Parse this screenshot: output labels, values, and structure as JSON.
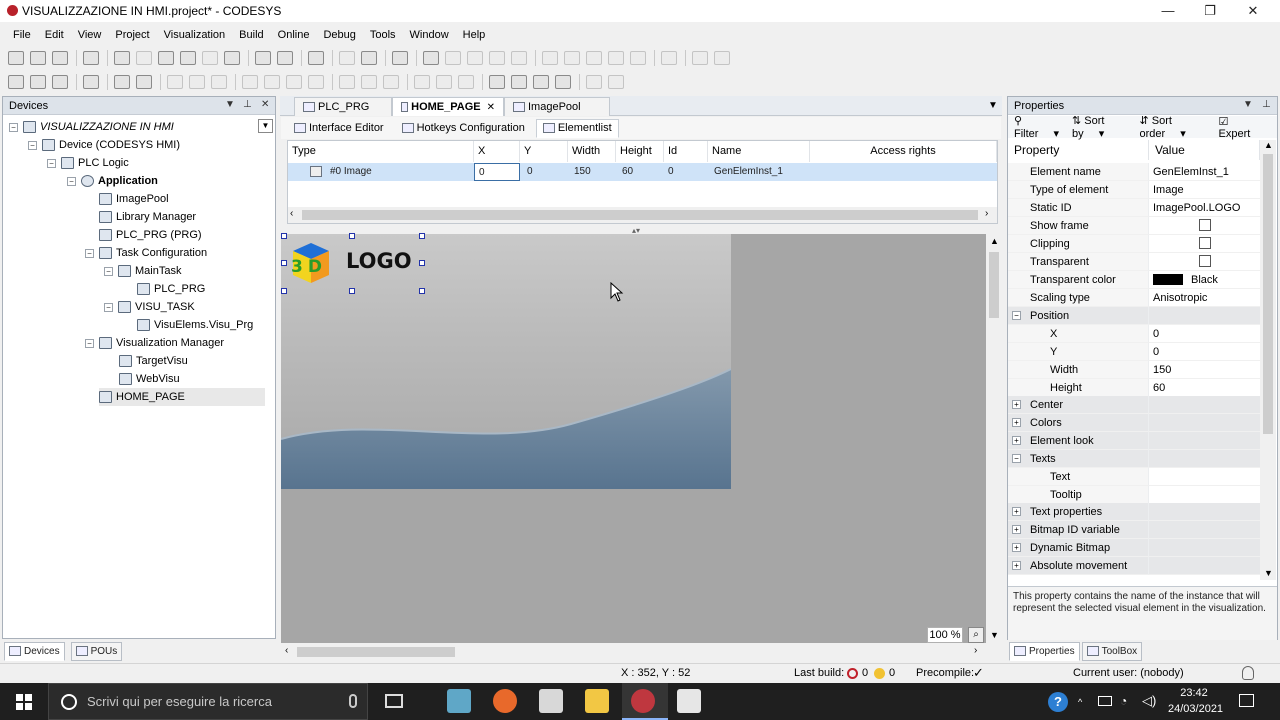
{
  "window": {
    "title": "VISUALIZZAZIONE IN HMI.project* - CODESYS"
  },
  "menu": [
    "File",
    "Edit",
    "View",
    "Project",
    "Visualization",
    "Build",
    "Online",
    "Debug",
    "Tools",
    "Window",
    "Help"
  ],
  "devices_panel": {
    "title": "Devices",
    "tree": [
      {
        "label": "VISUALIZZAZIONE IN HMI",
        "italic": true
      },
      {
        "label": "Device (CODESYS HMI)"
      },
      {
        "label": "PLC Logic"
      },
      {
        "label": "Application",
        "bold": true
      },
      {
        "label": "ImagePool"
      },
      {
        "label": "Library Manager"
      },
      {
        "label": "PLC_PRG (PRG)"
      },
      {
        "label": "Task Configuration"
      },
      {
        "label": "MainTask"
      },
      {
        "label": "PLC_PRG"
      },
      {
        "label": "VISU_TASK"
      },
      {
        "label": "VisuElems.Visu_Prg"
      },
      {
        "label": "Visualization Manager"
      },
      {
        "label": "TargetVisu"
      },
      {
        "label": "WebVisu"
      },
      {
        "label": "HOME_PAGE"
      }
    ],
    "tabs": [
      "Devices",
      "POUs"
    ]
  },
  "editor": {
    "tabs": [
      "PLC_PRG",
      "HOME_PAGE",
      "ImagePool"
    ],
    "subtabs": [
      "Interface Editor",
      "Hotkeys Configuration",
      "Elementlist"
    ],
    "columns": [
      "Type",
      "X",
      "Y",
      "Width",
      "Height",
      "Id",
      "Name",
      "Access rights"
    ],
    "row": {
      "type": "#0 Image",
      "x": "0",
      "y": "0",
      "width": "150",
      "height": "60",
      "id": "0",
      "name": "GenElemInst_1"
    },
    "logo_text": "LOGO",
    "logo_letters": "3D",
    "zoom": "100 %"
  },
  "properties_panel": {
    "title": "Properties",
    "toolbar": [
      "Filter",
      "Sort by",
      "Sort order",
      "Expert"
    ],
    "columns": [
      "Property",
      "Value"
    ],
    "rows": [
      {
        "name": "Element name",
        "value": "GenElemInst_1"
      },
      {
        "name": "Type of element",
        "value": "Image"
      },
      {
        "name": "Static ID",
        "value": "ImagePool.LOGO"
      },
      {
        "name": "Show frame",
        "value": ""
      },
      {
        "name": "Clipping",
        "value": ""
      },
      {
        "name": "Transparent",
        "value": ""
      },
      {
        "name": "Transparent color",
        "value": "Black"
      },
      {
        "name": "Scaling type",
        "value": "Anisotropic"
      },
      {
        "name": "Position",
        "value": ""
      },
      {
        "name": "X",
        "value": "0"
      },
      {
        "name": "Y",
        "value": "0"
      },
      {
        "name": "Width",
        "value": "150"
      },
      {
        "name": "Height",
        "value": "60"
      },
      {
        "name": "Center",
        "value": ""
      },
      {
        "name": "Colors",
        "value": ""
      },
      {
        "name": "Element look",
        "value": ""
      },
      {
        "name": "Texts",
        "value": ""
      },
      {
        "name": "Text",
        "value": ""
      },
      {
        "name": "Tooltip",
        "value": ""
      },
      {
        "name": "Text properties",
        "value": ""
      },
      {
        "name": "Bitmap ID variable",
        "value": ""
      },
      {
        "name": "Dynamic Bitmap",
        "value": ""
      },
      {
        "name": "Absolute movement",
        "value": ""
      }
    ],
    "description": "This property contains the name of the instance that will represent the selected visual element in the visualization.",
    "tabs": [
      "Properties",
      "ToolBox"
    ]
  },
  "statusbar": {
    "coords": "X : 352, Y : 52",
    "last_build_label": "Last build:",
    "errors": "0",
    "warnings": "0",
    "precompile_label": "Precompile:",
    "current_user": "Current user: (nobody)"
  },
  "taskbar": {
    "search_placeholder": "Scrivi qui per eseguire la ricerca",
    "time": "23:42",
    "date": "24/03/2021"
  },
  "colors": {
    "accent": "#cfe3f8",
    "title_icon": "#b8212a"
  }
}
